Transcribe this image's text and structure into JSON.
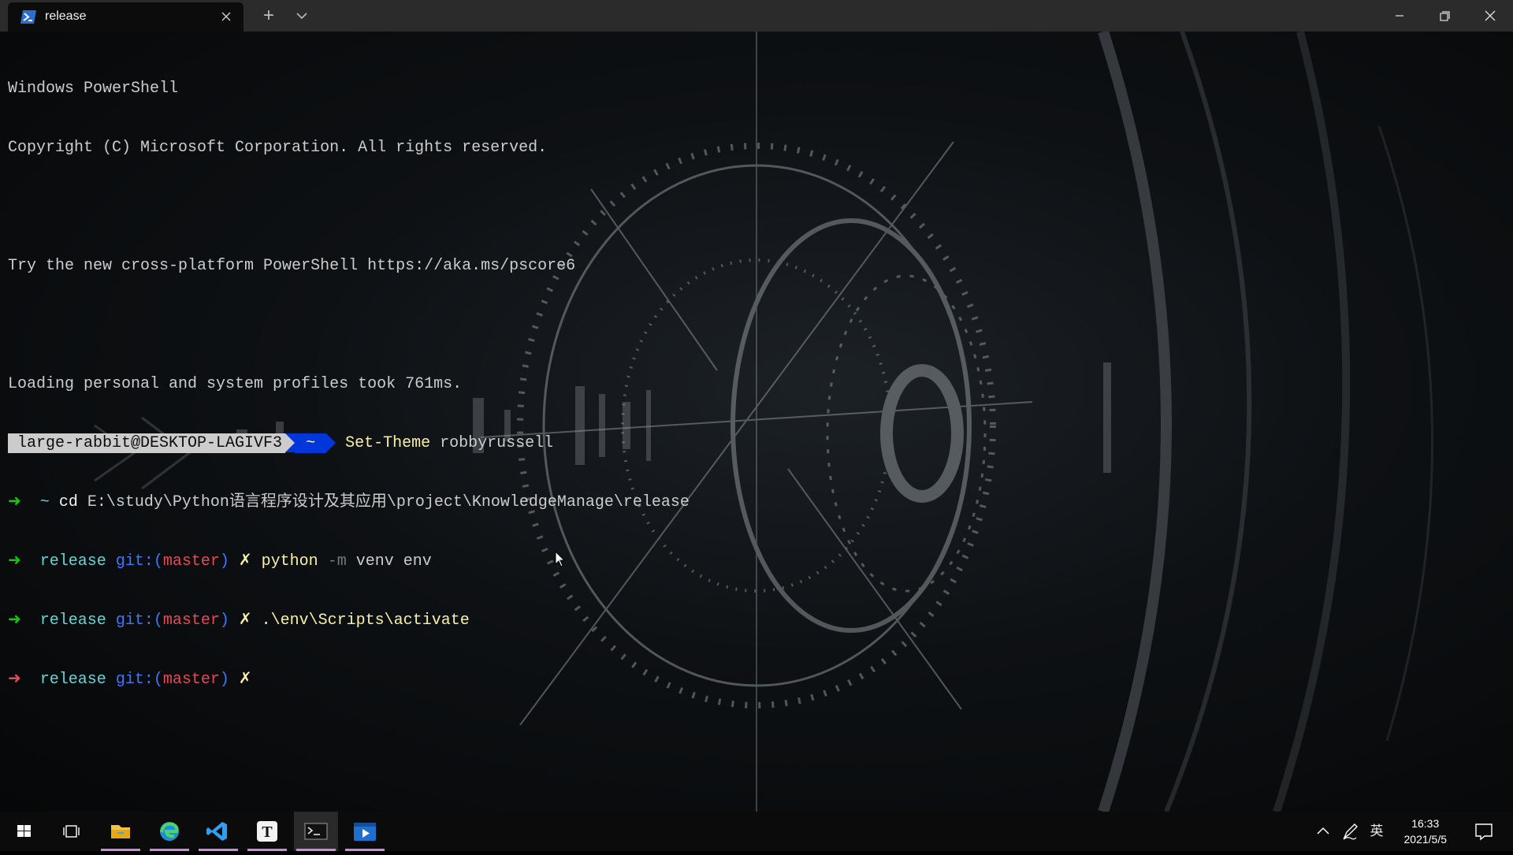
{
  "window": {
    "tab_title": "release",
    "tab_icon": "powershell-icon",
    "new_tab_label": "+"
  },
  "terminal": {
    "lines": {
      "l1": "Windows PowerShell",
      "l2": "Copyright (C) Microsoft Corporation. All rights reserved.",
      "l4": "Try the new cross-platform PowerShell https://aka.ms/pscore6",
      "l6": "Loading personal and system profiles took 761ms."
    },
    "prompt1": {
      "host": "large-rabbit@DESKTOP-LAGIVF3",
      "path": "~",
      "command": "Set-Theme",
      "arg": "robbyrussell"
    },
    "prompt2": {
      "arrow": "➜",
      "tilde": "~",
      "command": "cd",
      "arg": "E:\\study\\Python语言程序设计及其应用\\project\\KnowledgeManage\\release"
    },
    "prompt3": {
      "arrow": "➜",
      "dir": "release",
      "git": "git:(",
      "branch": "master",
      "git_close": ")",
      "dirty": "✗",
      "command": "python",
      "flag": "-m",
      "arg": "venv env"
    },
    "prompt4": {
      "arrow": "➜",
      "dir": "release",
      "git": "git:(",
      "branch": "master",
      "git_close": ")",
      "dirty": "✗",
      "command": ".\\env\\Scripts\\activate"
    },
    "prompt5": {
      "arrow": "➜",
      "dir": "release",
      "git": "git:(",
      "branch": "master",
      "git_close": ")",
      "dirty": "✗"
    }
  },
  "taskbar": {
    "items": [
      "windows-start-icon",
      "task-view-icon",
      "file-explorer-icon",
      "edge-icon",
      "vscode-icon",
      "typora-icon",
      "terminal-icon",
      "media-player-icon"
    ],
    "ime": "英",
    "time": "16:33",
    "date": "2021/5/5"
  },
  "colors": {
    "prompt_host_bg": "#cccccc",
    "prompt_path_bg": "#0037da",
    "green": "#16c60c",
    "red": "#e74856",
    "cyan": "#61d6d6",
    "blue": "#3b78ff",
    "yellow": "#f9f1a5"
  }
}
